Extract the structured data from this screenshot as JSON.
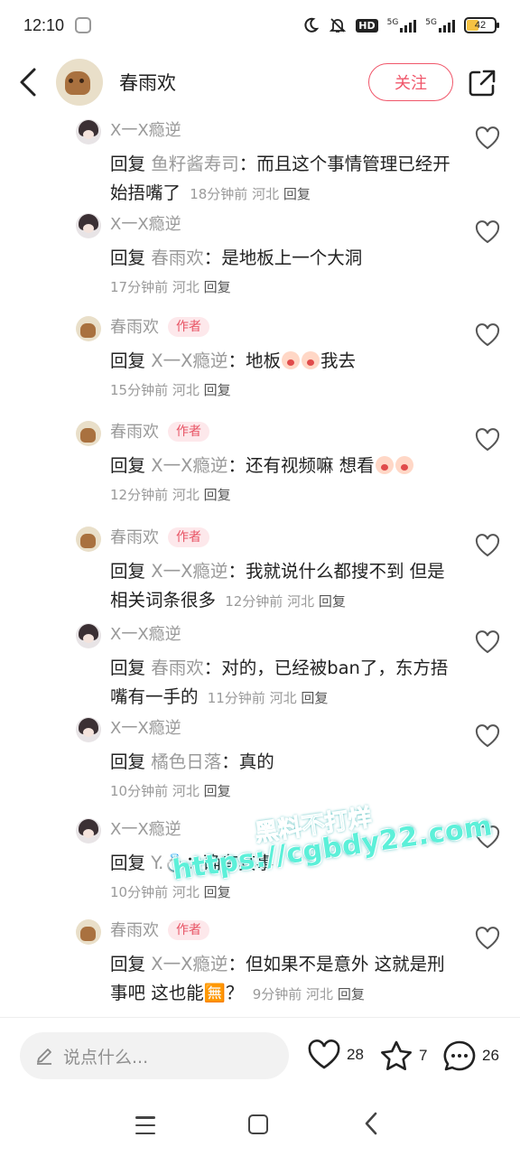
{
  "status_bar": {
    "time": "12:10",
    "network_1": "5G",
    "network_2": "5G",
    "battery": "42",
    "hd_label": "HD",
    "colors": {
      "battery_fill": "#f5c242"
    }
  },
  "header": {
    "title": "春雨欢",
    "follow_label": "关注",
    "colors": {
      "accent": "#f0566a"
    }
  },
  "author_tag": "作者",
  "reply_word": "回复",
  "comments": [
    {
      "name": "X一X瘾逆",
      "avatar": "girl",
      "is_author": false,
      "reply_to": "鱼籽酱寿司",
      "text": "：而且这个事情管理已经开始捂嘴了",
      "time": "18分钟前",
      "location": "河北",
      "reply_label": "回复"
    },
    {
      "name": "X一X瘾逆",
      "avatar": "girl",
      "is_author": false,
      "reply_to": "春雨欢",
      "text": "：是地板上一个大洞",
      "time": "17分钟前",
      "location": "河北",
      "reply_label": "回复"
    },
    {
      "name": "春雨欢",
      "avatar": "capybara",
      "is_author": true,
      "reply_to": "X一X瘾逆",
      "text_before": "：地板",
      "emoji_count": 2,
      "text_after": "我去",
      "time": "15分钟前",
      "location": "河北",
      "reply_label": "回复"
    },
    {
      "name": "春雨欢",
      "avatar": "capybara",
      "is_author": true,
      "reply_to": "X一X瘾逆",
      "text_before": "：还有视频嘛 想看",
      "emoji_count": 2,
      "text_after": "",
      "time": "12分钟前",
      "location": "河北",
      "reply_label": "回复"
    },
    {
      "name": "春雨欢",
      "avatar": "capybara",
      "is_author": true,
      "reply_to": "X一X瘾逆",
      "text": "：我就说什么都搜不到 但是相关词条很多",
      "time": "12分钟前",
      "location": "河北",
      "reply_label": "回复"
    },
    {
      "name": "X一X瘾逆",
      "avatar": "girl",
      "is_author": false,
      "reply_to": "春雨欢",
      "text": "：对的，已经被ban了，东方捂嘴有一手的",
      "time": "11分钟前",
      "location": "河北",
      "reply_label": "回复"
    },
    {
      "name": "X一X瘾逆",
      "avatar": "girl",
      "is_author": false,
      "reply_to": "橘色日落",
      "text": "：真的",
      "time": "10分钟前",
      "location": "河北",
      "reply_label": "回复"
    },
    {
      "name": "X一X瘾逆",
      "avatar": "girl",
      "is_author": false,
      "reply_to": "Y.💍",
      "text": "：确有其事",
      "time": "10分钟前",
      "location": "河北",
      "reply_label": "回复"
    },
    {
      "name": "春雨欢",
      "avatar": "capybara",
      "is_author": true,
      "reply_to": "X一X瘾逆",
      "text": "：但如果不是意外 这就是刑事吧 这也能🈚？",
      "time": "9分钟前",
      "location": "河北",
      "reply_label": "回复"
    }
  ],
  "watermark": {
    "line1": "黑料不打烊",
    "line2": "https://cgbdy22.com"
  },
  "bottom_bar": {
    "input_placeholder": "说点什么...",
    "likes": "28",
    "favorites": "7",
    "comments": "26"
  },
  "icons": {
    "back": "back-arrow-icon",
    "share": "share-icon",
    "like": "heart-icon",
    "favorite": "star-icon",
    "comment": "comment-bubble-icon",
    "pen": "pen-icon"
  }
}
